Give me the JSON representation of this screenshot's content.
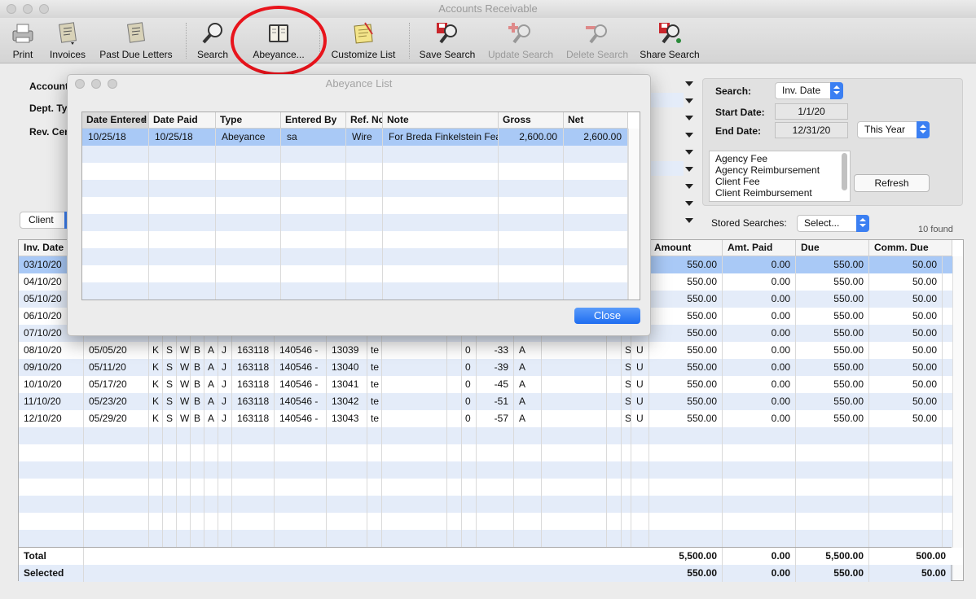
{
  "window": {
    "title": "Accounts Receivable"
  },
  "toolbar": [
    {
      "label": "Print",
      "icon": "printer-icon",
      "enabled": true
    },
    {
      "label": "Invoices",
      "icon": "invoice-icon",
      "enabled": true
    },
    {
      "label": "Past Due Letters",
      "icon": "letters-icon",
      "enabled": true
    },
    {
      "label": "Search",
      "icon": "magnifier-icon",
      "enabled": true
    },
    {
      "label": "Abeyance...",
      "icon": "ledger-book-icon",
      "enabled": true
    },
    {
      "label": "Customize List",
      "icon": "notepad-icon",
      "enabled": true
    },
    {
      "label": "Save Search",
      "icon": "save-search-icon",
      "enabled": true
    },
    {
      "label": "Update Search",
      "icon": "update-search-icon",
      "enabled": false
    },
    {
      "label": "Delete Search",
      "icon": "delete-search-icon",
      "enabled": false
    },
    {
      "label": "Share Search",
      "icon": "share-search-icon",
      "enabled": true
    }
  ],
  "filters": {
    "account_label": "Account",
    "dept_label": "Dept. Ty",
    "rev_label": "Rev. Cen",
    "client_tab": "Client"
  },
  "search": {
    "search_label": "Search:",
    "search_value": "Inv. Date",
    "start_label": "Start Date:",
    "start_value": "1/1/20",
    "end_label": "End Date:",
    "end_value": "12/31/20",
    "range_value": "This Year",
    "categories": [
      "Agency Fee",
      "Agency Reimbursement",
      "Client Fee",
      "Client Reimbursement"
    ],
    "refresh_label": "Refresh",
    "stored_label": "Stored Searches:",
    "stored_value": "Select...",
    "found": "10 found"
  },
  "main_table": {
    "headers": {
      "inv_date": "Inv. Date",
      "amount": "Amount",
      "amt_paid": "Amt. Paid",
      "due": "Due",
      "comm_due": "Comm. Due"
    },
    "rows": [
      {
        "inv": "03/10/20",
        "d2": "",
        "c": [
          "",
          "",
          "",
          "",
          "",
          ""
        ],
        "n1": "",
        "n2": "",
        "n3": "",
        "n4": "",
        "z": "",
        "neg": "",
        "a": "",
        "s": "",
        "u": "",
        "amount": "550.00",
        "paid": "0.00",
        "due": "550.00",
        "comm": "50.00"
      },
      {
        "inv": "04/10/20",
        "d2": "",
        "c": [
          "",
          "",
          "",
          "",
          "",
          ""
        ],
        "n1": "",
        "n2": "",
        "n3": "",
        "n4": "",
        "z": "",
        "neg": "",
        "a": "",
        "s": "",
        "u": "",
        "amount": "550.00",
        "paid": "0.00",
        "due": "550.00",
        "comm": "50.00"
      },
      {
        "inv": "05/10/20",
        "d2": "",
        "c": [
          "",
          "",
          "",
          "",
          "",
          ""
        ],
        "n1": "",
        "n2": "",
        "n3": "",
        "n4": "",
        "z": "",
        "neg": "",
        "a": "",
        "s": "",
        "u": "",
        "amount": "550.00",
        "paid": "0.00",
        "due": "550.00",
        "comm": "50.00"
      },
      {
        "inv": "06/10/20",
        "d2": "",
        "c": [
          "",
          "",
          "",
          "",
          "",
          ""
        ],
        "n1": "",
        "n2": "",
        "n3": "",
        "n4": "",
        "z": "",
        "neg": "",
        "a": "",
        "s": "",
        "u": "",
        "amount": "550.00",
        "paid": "0.00",
        "due": "550.00",
        "comm": "50.00"
      },
      {
        "inv": "07/10/20",
        "d2": "",
        "c": [
          "",
          "",
          "",
          "",
          "",
          ""
        ],
        "n1": "",
        "n2": "",
        "n3": "",
        "n4": "",
        "z": "",
        "neg": "",
        "a": "",
        "s": "",
        "u": "",
        "amount": "550.00",
        "paid": "0.00",
        "due": "550.00",
        "comm": "50.00"
      },
      {
        "inv": "08/10/20",
        "d2": "05/05/20",
        "c": [
          "K",
          "S",
          "W",
          "B",
          "A",
          "J"
        ],
        "n1": "163118",
        "n2": "140546 -",
        "n3": "13039",
        "n4": "te",
        "z": "0",
        "neg": "-33",
        "a": "A",
        "s": "S",
        "u": "U",
        "amount": "550.00",
        "paid": "0.00",
        "due": "550.00",
        "comm": "50.00"
      },
      {
        "inv": "09/10/20",
        "d2": "05/11/20",
        "c": [
          "K",
          "S",
          "W",
          "B",
          "A",
          "J"
        ],
        "n1": "163118",
        "n2": "140546 -",
        "n3": "13040",
        "n4": "te",
        "z": "0",
        "neg": "-39",
        "a": "A",
        "s": "S",
        "u": "U",
        "amount": "550.00",
        "paid": "0.00",
        "due": "550.00",
        "comm": "50.00"
      },
      {
        "inv": "10/10/20",
        "d2": "05/17/20",
        "c": [
          "K",
          "S",
          "W",
          "B",
          "A",
          "J"
        ],
        "n1": "163118",
        "n2": "140546 -",
        "n3": "13041",
        "n4": "te",
        "z": "0",
        "neg": "-45",
        "a": "A",
        "s": "S",
        "u": "U",
        "amount": "550.00",
        "paid": "0.00",
        "due": "550.00",
        "comm": "50.00"
      },
      {
        "inv": "11/10/20",
        "d2": "05/23/20",
        "c": [
          "K",
          "S",
          "W",
          "B",
          "A",
          "J"
        ],
        "n1": "163118",
        "n2": "140546 -",
        "n3": "13042",
        "n4": "te",
        "z": "0",
        "neg": "-51",
        "a": "A",
        "s": "S",
        "u": "U",
        "amount": "550.00",
        "paid": "0.00",
        "due": "550.00",
        "comm": "50.00"
      },
      {
        "inv": "12/10/20",
        "d2": "05/29/20",
        "c": [
          "K",
          "S",
          "W",
          "B",
          "A",
          "J"
        ],
        "n1": "163118",
        "n2": "140546 -",
        "n3": "13043",
        "n4": "te",
        "z": "0",
        "neg": "-57",
        "a": "A",
        "s": "S",
        "u": "U",
        "amount": "550.00",
        "paid": "0.00",
        "due": "550.00",
        "comm": "50.00"
      }
    ],
    "total": {
      "label": "Total",
      "amount": "5,500.00",
      "paid": "0.00",
      "due": "5,500.00",
      "comm": "500.00"
    },
    "selected": {
      "label": "Selected",
      "amount": "550.00",
      "paid": "0.00",
      "due": "550.00",
      "comm": "50.00"
    }
  },
  "dialog": {
    "title": "Abeyance List",
    "headers": [
      "Date Entered",
      "Date Paid",
      "Type",
      "Entered By",
      "Ref. No",
      "Note",
      "Gross",
      "Net"
    ],
    "rows": [
      [
        "10/25/18",
        "10/25/18",
        "Abeyance",
        "sa",
        "Wire",
        "For Breda Finkelstein Fea",
        "2,600.00",
        "2,600.00"
      ]
    ],
    "close_label": "Close"
  },
  "colors": {
    "selection": "#a9c9f6",
    "stripe": "#e4ecf9",
    "accent": "#2a76f0",
    "annotation": "#e8141c"
  }
}
